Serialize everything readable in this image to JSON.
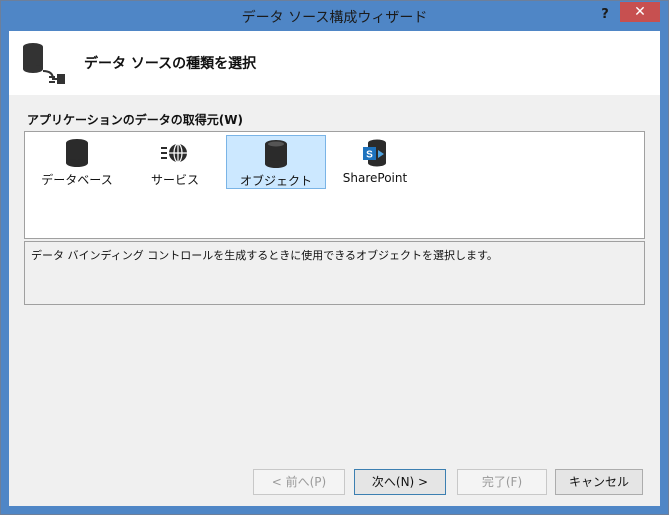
{
  "window": {
    "title": "データ ソース構成ウィザード",
    "help_label": "?",
    "close_label": "✕"
  },
  "header": {
    "title": "データ ソースの種類を選択"
  },
  "source_label": "アプリケーションのデータの取得元(W)",
  "sources": [
    {
      "label": "データベース",
      "icon": "database-icon",
      "selected": false
    },
    {
      "label": "サービス",
      "icon": "service-globe-icon",
      "selected": false
    },
    {
      "label": "オブジェクト",
      "icon": "object-icon",
      "selected": true
    },
    {
      "label": "SharePoint",
      "icon": "sharepoint-icon",
      "selected": false
    }
  ],
  "description": "データ バインディング コントロールを生成するときに使用できるオブジェクトを選択します。",
  "buttons": {
    "back": "< 前へ(P)",
    "next": "次へ(N) >",
    "finish": "完了(F)",
    "cancel": "キャンセル"
  },
  "colors": {
    "titlebar": "#4f86c6",
    "close": "#c75050",
    "selection": "#cce8ff"
  }
}
